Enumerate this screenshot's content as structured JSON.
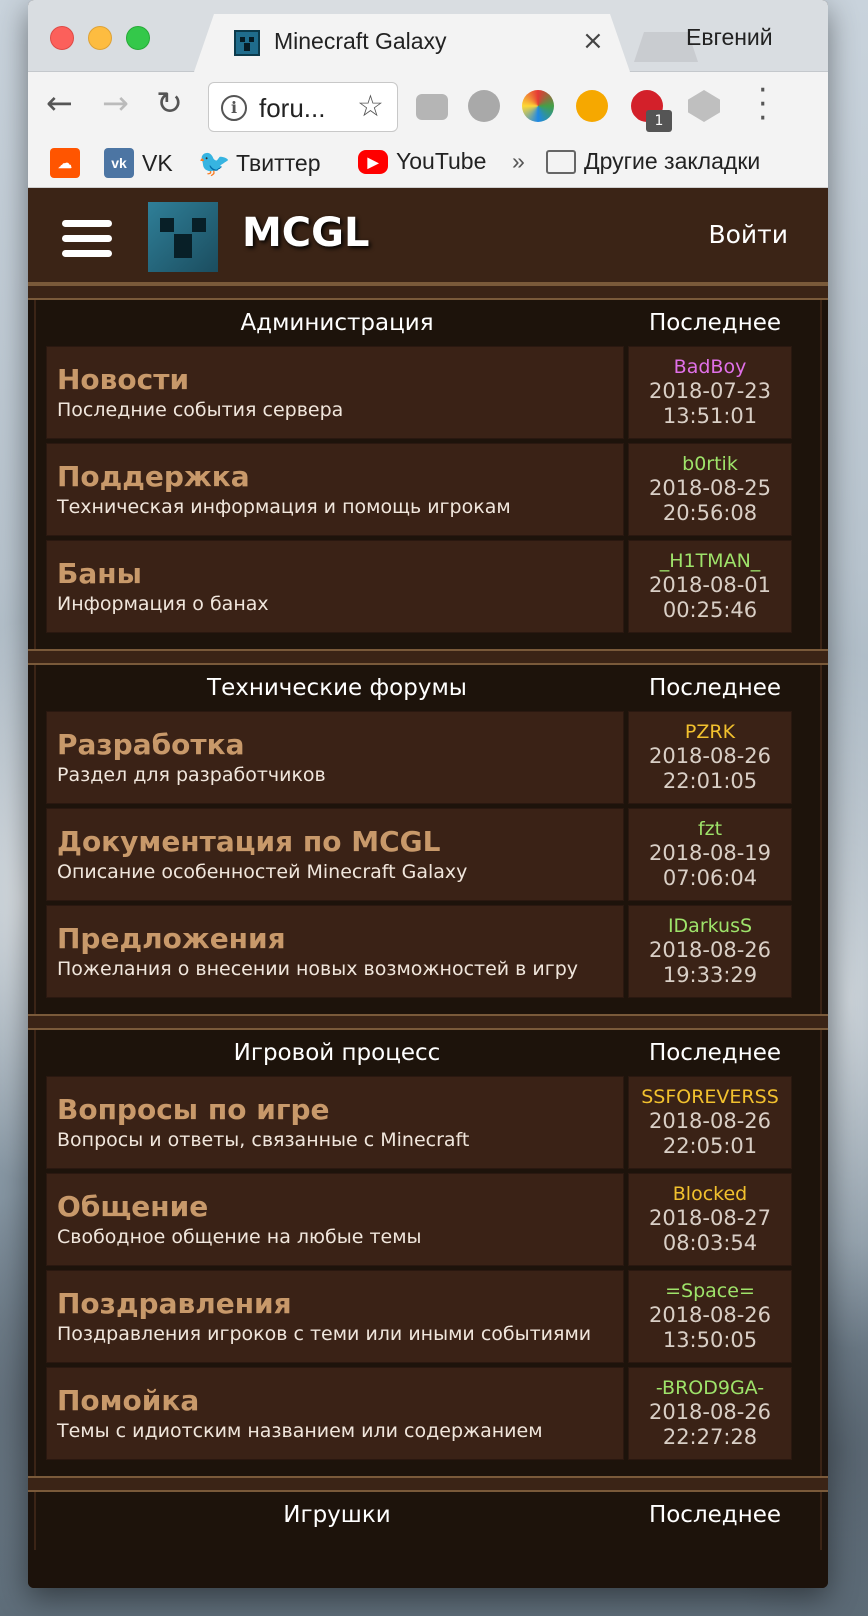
{
  "browser": {
    "tab_title": "Minecraft Galaxy",
    "tab_close": "×",
    "profile_name": "Евгений",
    "url_text": "foru...",
    "adblock_badge": "1",
    "bookmarks_overflow": "»",
    "bookmarks": [
      {
        "label": "",
        "icon": "soundcloud-icon"
      },
      {
        "label": "VK",
        "icon": "vk-icon"
      },
      {
        "label": "Твиттер",
        "icon": "twitter-icon"
      },
      {
        "label": "YouTube",
        "icon": "youtube-icon"
      },
      {
        "label": "Другие закладки",
        "icon": "folder-icon"
      }
    ]
  },
  "site": {
    "title": "MCGL",
    "login": "Войти"
  },
  "sections": [
    {
      "name": "Администрация",
      "last_header": "Последнее",
      "forums": [
        {
          "title": "Новости",
          "desc": "Последние события сервера",
          "user": "BadBoy",
          "user_color": "#e070e8",
          "date": "2018-07-23",
          "time": "13:51:01"
        },
        {
          "title": "Поддержка",
          "desc": "Техническая информация и помощь игрокам",
          "user": "b0rtik",
          "user_color": "#9ee36a",
          "date": "2018-08-25",
          "time": "20:56:08"
        },
        {
          "title": "Баны",
          "desc": "Информация о банах",
          "user": "_H1TMAN_",
          "user_color": "#9ee36a",
          "date": "2018-08-01",
          "time": "00:25:46"
        }
      ]
    },
    {
      "name": "Технические форумы",
      "last_header": "Последнее",
      "forums": [
        {
          "title": "Разработка",
          "desc": "Раздел для разработчиков",
          "user": "PZRK",
          "user_color": "#f2c12e",
          "date": "2018-08-26",
          "time": "22:01:05"
        },
        {
          "title": "Документация по MCGL",
          "desc": "Описание особенностей Minecraft Galaxy",
          "user": "fzt",
          "user_color": "#9ee36a",
          "date": "2018-08-19",
          "time": "07:06:04"
        },
        {
          "title": "Предложения",
          "desc": "Пожелания о внесении новых возможностей в игру",
          "user": "IDarkusS",
          "user_color": "#9ee36a",
          "date": "2018-08-26",
          "time": "19:33:29"
        }
      ]
    },
    {
      "name": "Игровой процесс",
      "last_header": "Последнее",
      "forums": [
        {
          "title": "Вопросы по игре",
          "desc": "Вопросы и ответы, связанные с Minecraft",
          "user": "SSFOREVERSS",
          "user_color": "#f2c12e",
          "date": "2018-08-26",
          "time": "22:05:01"
        },
        {
          "title": "Общение",
          "desc": "Свободное общение на любые темы",
          "user": "Blocked",
          "user_color": "#f2c12e",
          "date": "2018-08-27",
          "time": "08:03:54"
        },
        {
          "title": "Поздравления",
          "desc": "Поздравления игроков с теми или иными событиями",
          "user": "=Space=",
          "user_color": "#9ee36a",
          "date": "2018-08-26",
          "time": "13:50:05"
        },
        {
          "title": "Помойка",
          "desc": "Темы с идиотским названием или содержанием",
          "user": "-BROD9GA-",
          "user_color": "#9ee36a",
          "date": "2018-08-26",
          "time": "22:27:28"
        }
      ]
    },
    {
      "name": "Игрушки",
      "last_header": "Последнее",
      "forums": []
    }
  ]
}
